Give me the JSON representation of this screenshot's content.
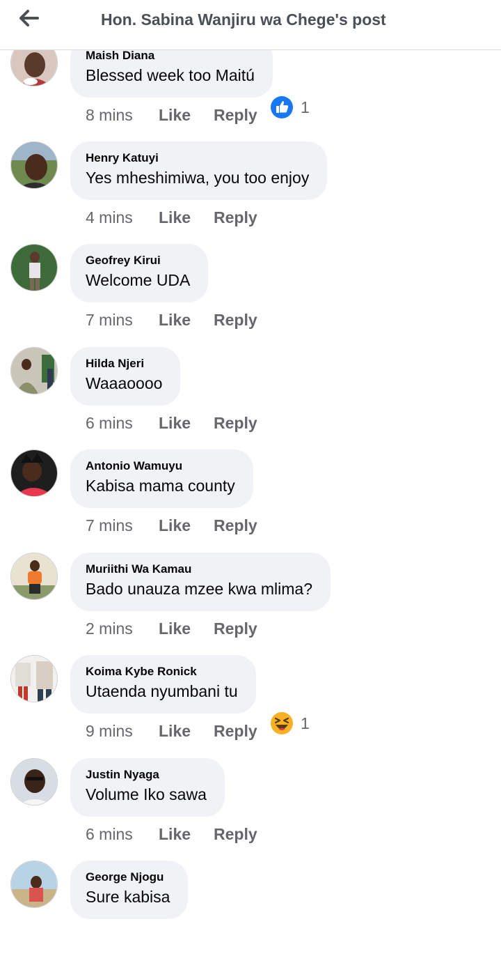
{
  "header": {
    "title": "Hon. Sabina Wanjiru wa Chege's post",
    "back_icon": "arrow-left-icon"
  },
  "actions": {
    "like": "Like",
    "reply": "Reply"
  },
  "colors": {
    "bubble": "#f0f2f5",
    "like_blue": "#1877f2",
    "haha_yellow": "#f7b125",
    "meta_gray": "#65676b"
  },
  "comments": [
    {
      "author": "Maish Diana",
      "text": "Blessed week too Maitú",
      "time": "8 mins",
      "reaction": {
        "icon": "like-reaction-icon",
        "count": "1"
      }
    },
    {
      "author": "Henry Katuyi",
      "text": "Yes mheshimiwa, you too enjoy",
      "time": "4 mins"
    },
    {
      "author": "Geofrey Kirui",
      "text": "Welcome UDA",
      "time": "7 mins"
    },
    {
      "author": "Hilda Njeri",
      "text": "Waaaoooo",
      "time": "6 mins"
    },
    {
      "author": "Antonio Wamuyu",
      "text": "Kabisa mama county",
      "time": "7 mins"
    },
    {
      "author": "Muriithi Wa Kamau",
      "text": "Bado unauza mzee kwa mlima?",
      "time": "2 mins"
    },
    {
      "author": "Koima Kybe Ronick",
      "text": "Utaenda nyumbani tu",
      "time": "9 mins",
      "reaction": {
        "icon": "haha-reaction-icon",
        "count": "1"
      }
    },
    {
      "author": "Justin Nyaga",
      "text": "Volume Iko sawa",
      "time": "6 mins"
    },
    {
      "author": "George Njogu",
      "text": "Sure kabisa",
      "time": ""
    }
  ]
}
